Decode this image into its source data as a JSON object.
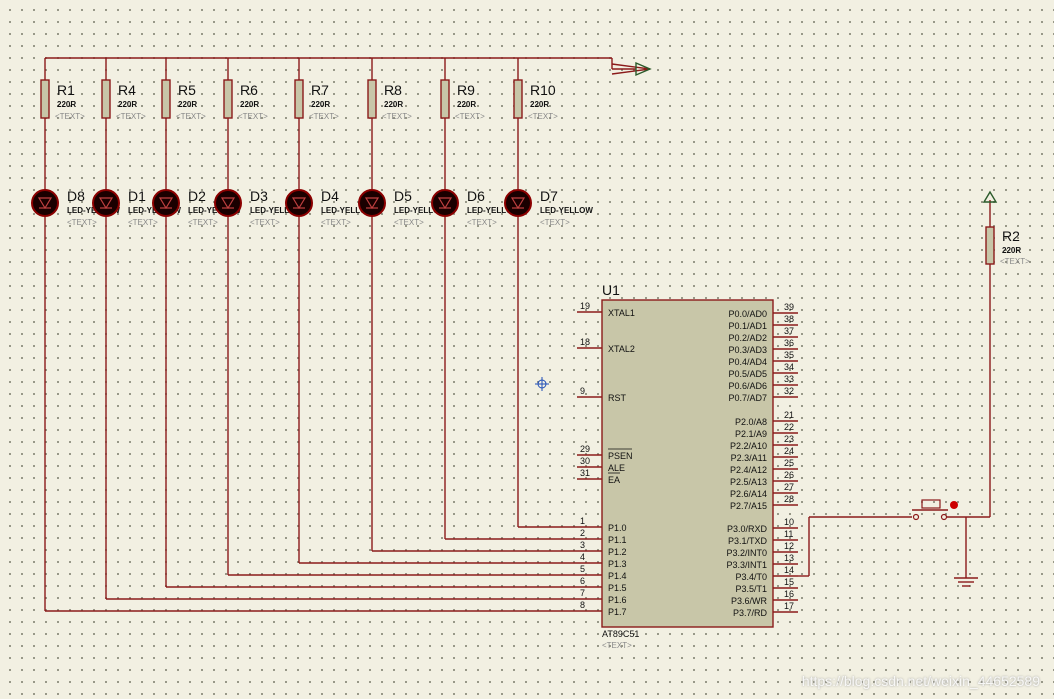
{
  "resistors": [
    {
      "ref": "R1",
      "value": "220R",
      "text": "<TEXT>"
    },
    {
      "ref": "R4",
      "value": "220R",
      "text": "<TEXT>"
    },
    {
      "ref": "R5",
      "value": "220R",
      "text": "<TEXT>"
    },
    {
      "ref": "R6",
      "value": "220R",
      "text": "<TEXT>"
    },
    {
      "ref": "R7",
      "value": "220R",
      "text": "<TEXT>"
    },
    {
      "ref": "R8",
      "value": "220R",
      "text": "<TEXT>"
    },
    {
      "ref": "R9",
      "value": "220R",
      "text": "<TEXT>"
    },
    {
      "ref": "R10",
      "value": "220R",
      "text": "<TEXT>"
    }
  ],
  "leds": [
    {
      "ref": "D8",
      "value": "LED-YELLOW",
      "text": "<TEXT>"
    },
    {
      "ref": "D1",
      "value": "LED-YELLOW",
      "text": "<TEXT>"
    },
    {
      "ref": "D2",
      "value": "LED-YELLOW",
      "text": "<TEXT>"
    },
    {
      "ref": "D3",
      "value": "LED-YELLOW",
      "text": "<TEXT>"
    },
    {
      "ref": "D4",
      "value": "LED-YELLOW",
      "text": "<TEXT>"
    },
    {
      "ref": "D5",
      "value": "LED-YELLOW",
      "text": "<TEXT>"
    },
    {
      "ref": "D6",
      "value": "LED-YELLOW",
      "text": "<TEXT>"
    },
    {
      "ref": "D7",
      "value": "LED-YELLOW",
      "text": "<TEXT>"
    }
  ],
  "r2": {
    "ref": "R2",
    "value": "220R",
    "text": "<TEXT>"
  },
  "chip": {
    "ref": "U1",
    "name": "AT89C51",
    "text": "<TEXT>",
    "left_pins": [
      {
        "num": "19",
        "label": "XTAL1"
      },
      {
        "num": "18",
        "label": "XTAL2"
      },
      {
        "num": "9",
        "label": "RST"
      },
      {
        "num": "29",
        "label": "PSEN"
      },
      {
        "num": "30",
        "label": "ALE"
      },
      {
        "num": "31",
        "label": "EA"
      },
      {
        "num": "1",
        "label": "P1.0"
      },
      {
        "num": "2",
        "label": "P1.1"
      },
      {
        "num": "3",
        "label": "P1.2"
      },
      {
        "num": "4",
        "label": "P1.3"
      },
      {
        "num": "5",
        "label": "P1.4"
      },
      {
        "num": "6",
        "label": "P1.5"
      },
      {
        "num": "7",
        "label": "P1.6"
      },
      {
        "num": "8",
        "label": "P1.7"
      }
    ],
    "right_pins": [
      {
        "num": "39",
        "label": "P0.0/AD0"
      },
      {
        "num": "38",
        "label": "P0.1/AD1"
      },
      {
        "num": "37",
        "label": "P0.2/AD2"
      },
      {
        "num": "36",
        "label": "P0.3/AD3"
      },
      {
        "num": "35",
        "label": "P0.4/AD4"
      },
      {
        "num": "34",
        "label": "P0.5/AD5"
      },
      {
        "num": "33",
        "label": "P0.6/AD6"
      },
      {
        "num": "32",
        "label": "P0.7/AD7"
      },
      {
        "num": "21",
        "label": "P2.0/A8"
      },
      {
        "num": "22",
        "label": "P2.1/A9"
      },
      {
        "num": "23",
        "label": "P2.2/A10"
      },
      {
        "num": "24",
        "label": "P2.3/A11"
      },
      {
        "num": "25",
        "label": "P2.4/A12"
      },
      {
        "num": "26",
        "label": "P2.5/A13"
      },
      {
        "num": "27",
        "label": "P2.6/A14"
      },
      {
        "num": "28",
        "label": "P2.7/A15"
      },
      {
        "num": "10",
        "label": "P3.0/RXD"
      },
      {
        "num": "11",
        "label": "P3.1/TXD"
      },
      {
        "num": "12",
        "label": "P3.2/INT0"
      },
      {
        "num": "13",
        "label": "P3.3/INT1"
      },
      {
        "num": "14",
        "label": "P3.4/T0"
      },
      {
        "num": "15",
        "label": "P3.5/T1"
      },
      {
        "num": "16",
        "label": "P3.6/WR"
      },
      {
        "num": "17",
        "label": "P3.7/RD"
      }
    ]
  },
  "watermark": "https://blog.csdn.net/weixin_44652589",
  "colors": {
    "wire": "#8b1a1a",
    "chip_fill": "#c8c6a8",
    "led_fill": "#1a0000",
    "led_glow": "#8b0000",
    "background": "#f2f0e2"
  }
}
